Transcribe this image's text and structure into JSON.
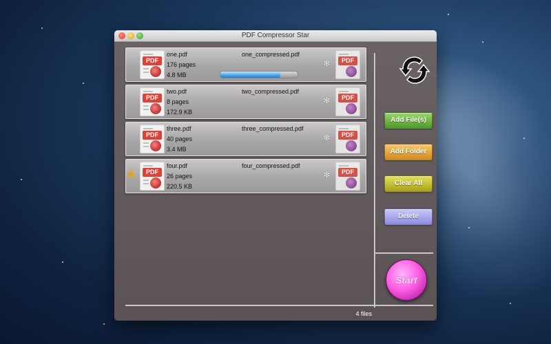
{
  "window": {
    "title": "PDF Compressor Star"
  },
  "files": [
    {
      "name": "one.pdf",
      "pages": "176 pages",
      "size": "4.8 MB",
      "output": "one_compressed.pdf",
      "progress": 0.78
    },
    {
      "name": "two.pdf",
      "pages": "8 pages",
      "size": "172.9 KB",
      "output": "two_compressed.pdf"
    },
    {
      "name": "three.pdf",
      "pages": "40 pages",
      "size": "3.4 MB",
      "output": "three_compressed.pdf"
    },
    {
      "name": "four.pdf",
      "pages": "26 pages",
      "size": "220.5 KB",
      "output": "four_compressed.pdf"
    }
  ],
  "icons": {
    "pdf_label": "PDF",
    "refresh": "refresh-icon",
    "gear": "gear-icon",
    "lock": "lock-icon",
    "pdf": "pdf-file-icon"
  },
  "buttons": {
    "add_files": "Add File(s)",
    "add_folder": "Add Folder",
    "clear_all": "Clear All",
    "delete": "Delete",
    "start": "Start"
  },
  "status": {
    "file_count": "4 files"
  }
}
